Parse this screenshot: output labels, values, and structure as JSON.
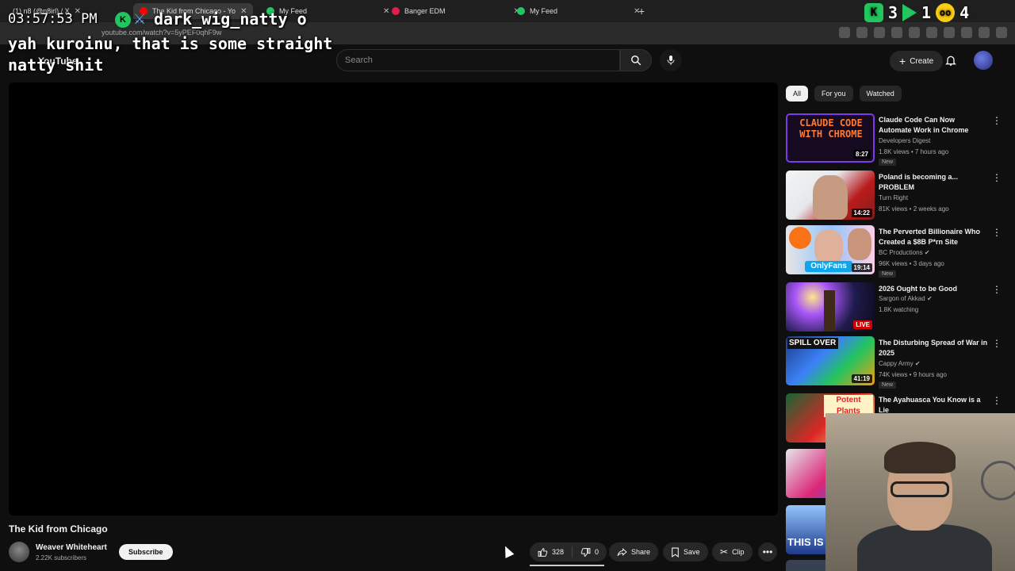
{
  "browser": {
    "tabs": [
      {
        "label": "(1) n8 (@n8irl) / X"
      },
      {
        "label": "The Kid from Chicago - Yo"
      },
      {
        "label": "My Feed"
      },
      {
        "label": "Banger EDM"
      },
      {
        "label": "My Feed"
      }
    ],
    "url": "youtube.com/watch?v=5yPEF0qhF9w"
  },
  "overlay": {
    "time": "03:57:53 PM",
    "username": "dark_wig_natty",
    "trailing": "o",
    "message": "yah kuroinu, that is some straight natty shit",
    "counter1": "3",
    "counter2": "1",
    "counter3": "1",
    "counter4": "4"
  },
  "header": {
    "logo": "YouTube",
    "search_placeholder": "Search",
    "create_label": "Create"
  },
  "video": {
    "title": "The Kid from Chicago",
    "channel": "Weaver Whiteheart",
    "subscribers": "2.22K subscribers",
    "subscribe_label": "Subscribe",
    "likes": "328",
    "dislikes": "0",
    "share_label": "Share",
    "save_label": "Save",
    "clip_label": "Clip"
  },
  "chips": [
    {
      "label": "All"
    },
    {
      "label": "For you"
    },
    {
      "label": "Watched"
    }
  ],
  "recommendations": [
    {
      "title": "Claude Code Can Now Automate Work in Chrome",
      "channel": "Developers Digest",
      "meta": "1.8K views • 7 hours ago",
      "badge": "New",
      "duration": "8:27",
      "thumb_text": "CLAUDE CODE WITH CHROME"
    },
    {
      "title": "Poland is becoming a... PROBLEM",
      "channel": "Turn Right",
      "meta": "81K views • 2 weeks ago",
      "duration": "14:22"
    },
    {
      "title": "The Perverted Billionaire Who Created a $8B P*rn Site",
      "channel": "BC Productions",
      "meta": "96K views • 3 days ago",
      "badge": "New",
      "duration": "19:14",
      "thumb_text": "OnlyFans"
    },
    {
      "title": "2026 Ought to be Good",
      "channel": "Sargon of Akkad",
      "meta": "1.8K watching",
      "live": "LIVE"
    },
    {
      "title": "The Disturbing Spread of War in 2025",
      "channel": "Cappy Army",
      "meta": "74K views • 9 hours ago",
      "badge": "New",
      "duration": "41:19",
      "thumb_text": "SPILL OVER"
    },
    {
      "title": "The Ayahuasca You Know is a Lie",
      "thumb_text": "Potent Plants"
    }
  ],
  "partial_thumbs": [
    {
      "thumb_text": ""
    },
    {
      "thumb_text": "THIS IS B"
    }
  ]
}
